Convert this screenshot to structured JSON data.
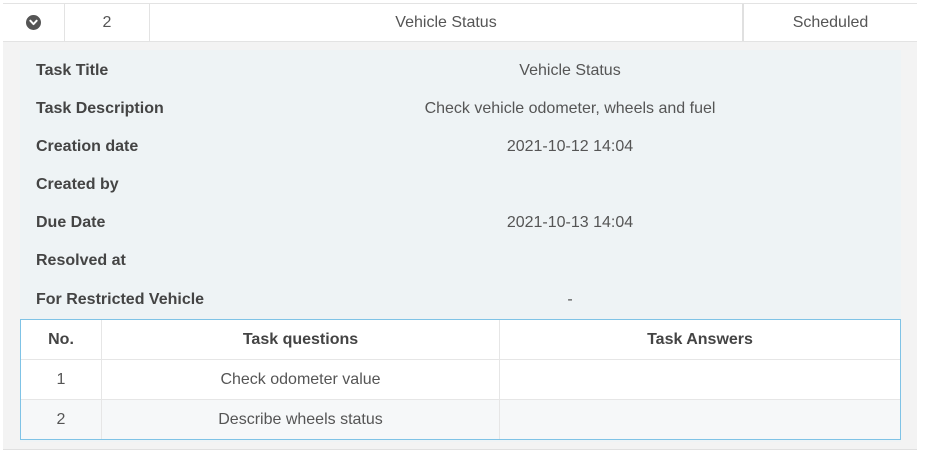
{
  "summary": {
    "toggle_icon": "chevron-circle-down-icon",
    "number": "2",
    "title": "Vehicle Status",
    "status": "Scheduled"
  },
  "details": [
    {
      "label": "Task Title",
      "value": "Vehicle Status"
    },
    {
      "label": "Task Description",
      "value": "Check vehicle odometer, wheels and fuel"
    },
    {
      "label": "Creation date",
      "value": "2021-10-12 14:04"
    },
    {
      "label": "Created by",
      "value": ""
    },
    {
      "label": "Due Date",
      "value": "2021-10-13 14:04"
    },
    {
      "label": "Resolved at",
      "value": ""
    },
    {
      "label": "For Restricted Vehicle",
      "value": "-"
    }
  ],
  "qa_table": {
    "headers": [
      "No.",
      "Task questions",
      "Task Answers"
    ],
    "rows": [
      {
        "no": "1",
        "question": "Check odometer value",
        "answer": ""
      },
      {
        "no": "2",
        "question": "Describe wheels status",
        "answer": ""
      }
    ]
  },
  "colors": {
    "table_border": "#7fc3e6",
    "panel_background": "#eef3f5"
  }
}
